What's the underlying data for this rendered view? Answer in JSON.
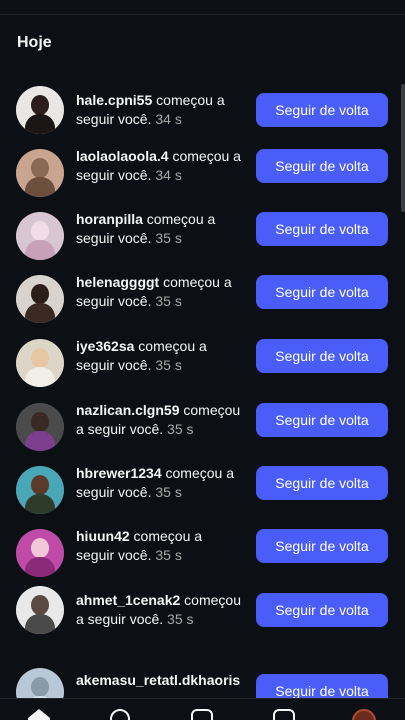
{
  "section": {
    "title": "Hoje"
  },
  "colors": {
    "background": "#0c1014",
    "button": "#4a5df9",
    "muted": "#a8a8a8"
  },
  "follow_button_label": "Seguir de volta",
  "notifications": [
    {
      "username": "hale.cpni55",
      "action": " começou a seguir você.",
      "time": " 34 s"
    },
    {
      "username": "laolaolaoola.4",
      "action": " começou a seguir você.",
      "time": " 34 s"
    },
    {
      "username": "horanpilla",
      "action": " começou a seguir você.",
      "time": " 35 s"
    },
    {
      "username": "helenaggggt",
      "action": " começou a seguir você.",
      "time": " 35 s"
    },
    {
      "username": "iye362sa",
      "action": " começou a seguir você.",
      "time": " 35 s"
    },
    {
      "username": "nazlican.clgn59",
      "action": " começou a seguir você.",
      "time": " 35 s"
    },
    {
      "username": "hbrewer1234",
      "action": " começou a seguir você.",
      "time": " 35 s"
    },
    {
      "username": "hiuun42",
      "action": " começou a seguir você.",
      "time": " 35 s"
    },
    {
      "username": "ahmet_1cenak2",
      "action": " começou a seguir você.",
      "time": " 35 s"
    },
    {
      "username": "akemasu_retatl.dkhaoris",
      "action": "",
      "time": ""
    }
  ],
  "nav": {
    "icons": [
      "home-icon",
      "search-icon",
      "create-icon",
      "reels-icon",
      "profile-icon"
    ]
  }
}
